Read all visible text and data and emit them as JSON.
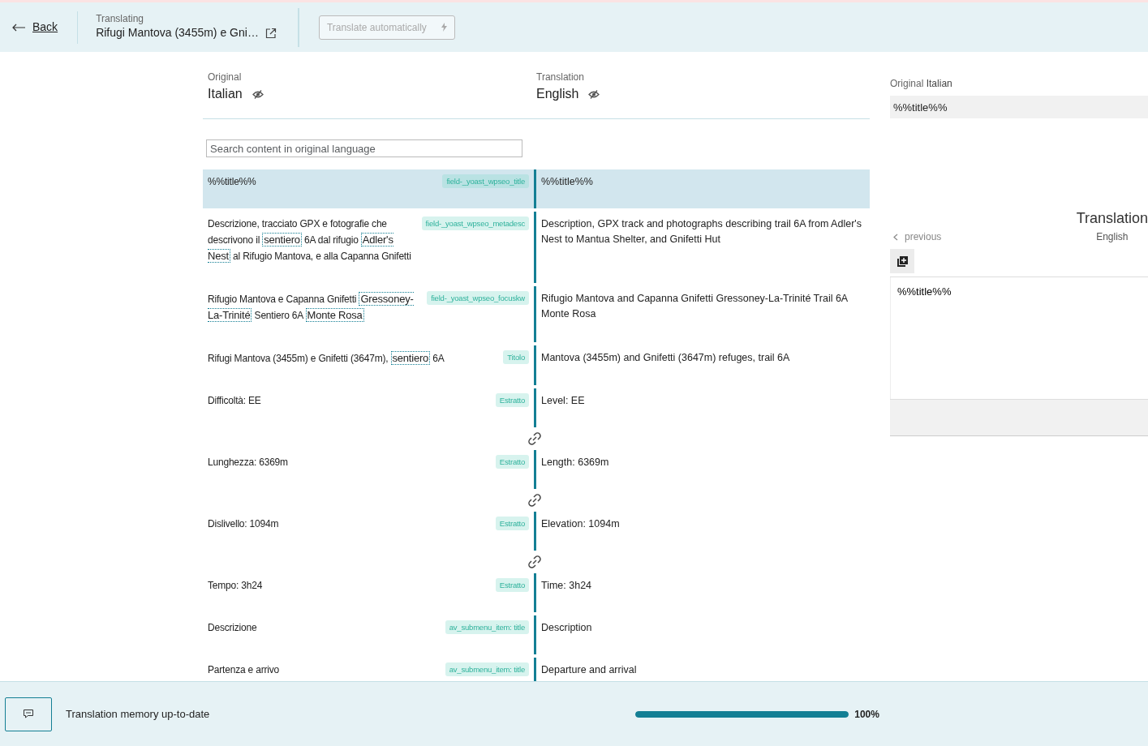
{
  "header": {
    "back_link": "Back",
    "context_label": "Translating",
    "document_title": "Rifugi Mantova (3455m) e Gni…",
    "auto_translate_button": {
      "label": "Translate automatically",
      "disabled": true
    }
  },
  "columns": {
    "original": {
      "label": "Original",
      "language": "Italian"
    },
    "translation": {
      "label": "Translation",
      "language": "English"
    }
  },
  "search": {
    "placeholder": "Search content in original language"
  },
  "segments": [
    {
      "selected": true,
      "linked": false,
      "tag": "field-_yoast_wpseo_title",
      "source_parts": [
        {
          "text": "%%title%%",
          "term": false
        }
      ],
      "target": "%%title%%"
    },
    {
      "selected": false,
      "linked": false,
      "tag": "field-_yoast_wpseo_metadesc",
      "source_parts": [
        {
          "text": "Descrizione, tracciato GPX e fotografie che descrivono il ",
          "term": false
        },
        {
          "text": "sentiero",
          "term": true
        },
        {
          "text": " 6A dal rifugio ",
          "term": false
        },
        {
          "text": "Adler's Nest",
          "term": true
        },
        {
          "text": " al Rifugio Mantova, e alla Capanna Gnifetti",
          "term": false
        }
      ],
      "target": "Description, GPX track and photographs describing trail 6A from Adler's Nest to Mantua Shelter, and Gnifetti Hut"
    },
    {
      "selected": false,
      "linked": false,
      "tag": "field-_yoast_wpseo_focuskw",
      "source_parts": [
        {
          "text": "Rifugio Mantova e Capanna Gnifetti ",
          "term": false
        },
        {
          "text": "Gressoney-La-Trinité",
          "term": true
        },
        {
          "text": " Sentiero 6A ",
          "term": false
        },
        {
          "text": "Monte Rosa",
          "term": true
        }
      ],
      "target": "Rifugio Mantova and Capanna Gnifetti Gressoney-La-Trinité Trail 6A Monte Rosa"
    },
    {
      "selected": false,
      "linked": false,
      "tag": "Titolo",
      "source_parts": [
        {
          "text": "Rifugi Mantova (3455m) e Gnifetti (3647m), ",
          "term": false
        },
        {
          "text": "sentiero",
          "term": true
        },
        {
          "text": " 6A",
          "term": false
        }
      ],
      "target": "Mantova (3455m) and Gnifetti (3647m) refuges, trail 6A"
    },
    {
      "selected": false,
      "linked": false,
      "tag": "Estratto",
      "source_parts": [
        {
          "text": "Difficoltà: EE",
          "term": false
        }
      ],
      "target": "Level: EE"
    },
    {
      "selected": false,
      "linked": true,
      "tag": "Estratto",
      "source_parts": [
        {
          "text": "Lunghezza: 6369m",
          "term": false
        }
      ],
      "target": "Length: 6369m"
    },
    {
      "selected": false,
      "linked": true,
      "tag": "Estratto",
      "source_parts": [
        {
          "text": "Dislivello: 1094m",
          "term": false
        }
      ],
      "target": "Elevation: 1094m"
    },
    {
      "selected": false,
      "linked": true,
      "tag": "Estratto",
      "source_parts": [
        {
          "text": "Tempo: 3h24",
          "term": false
        }
      ],
      "target": "Time: 3h24"
    },
    {
      "selected": false,
      "linked": false,
      "tag": "av_submenu_item: title",
      "source_parts": [
        {
          "text": "Descrizione",
          "term": false
        }
      ],
      "target": "Description"
    },
    {
      "selected": false,
      "linked": false,
      "tag": "av_submenu_item: title",
      "source_parts": [
        {
          "text": "Partenza e arrivo",
          "term": false
        }
      ],
      "target": "Departure and arrival"
    }
  ],
  "side_panel": {
    "original_label": "Original",
    "original_language": "Italian",
    "original_text": "%%title%%",
    "previous": "previous",
    "heading": "Translation",
    "heading_language": "English",
    "translation_value": "%%title%%"
  },
  "footer": {
    "status": "Translation memory up-to-date",
    "progress": {
      "level": 1,
      "reading": "100%"
    }
  }
}
